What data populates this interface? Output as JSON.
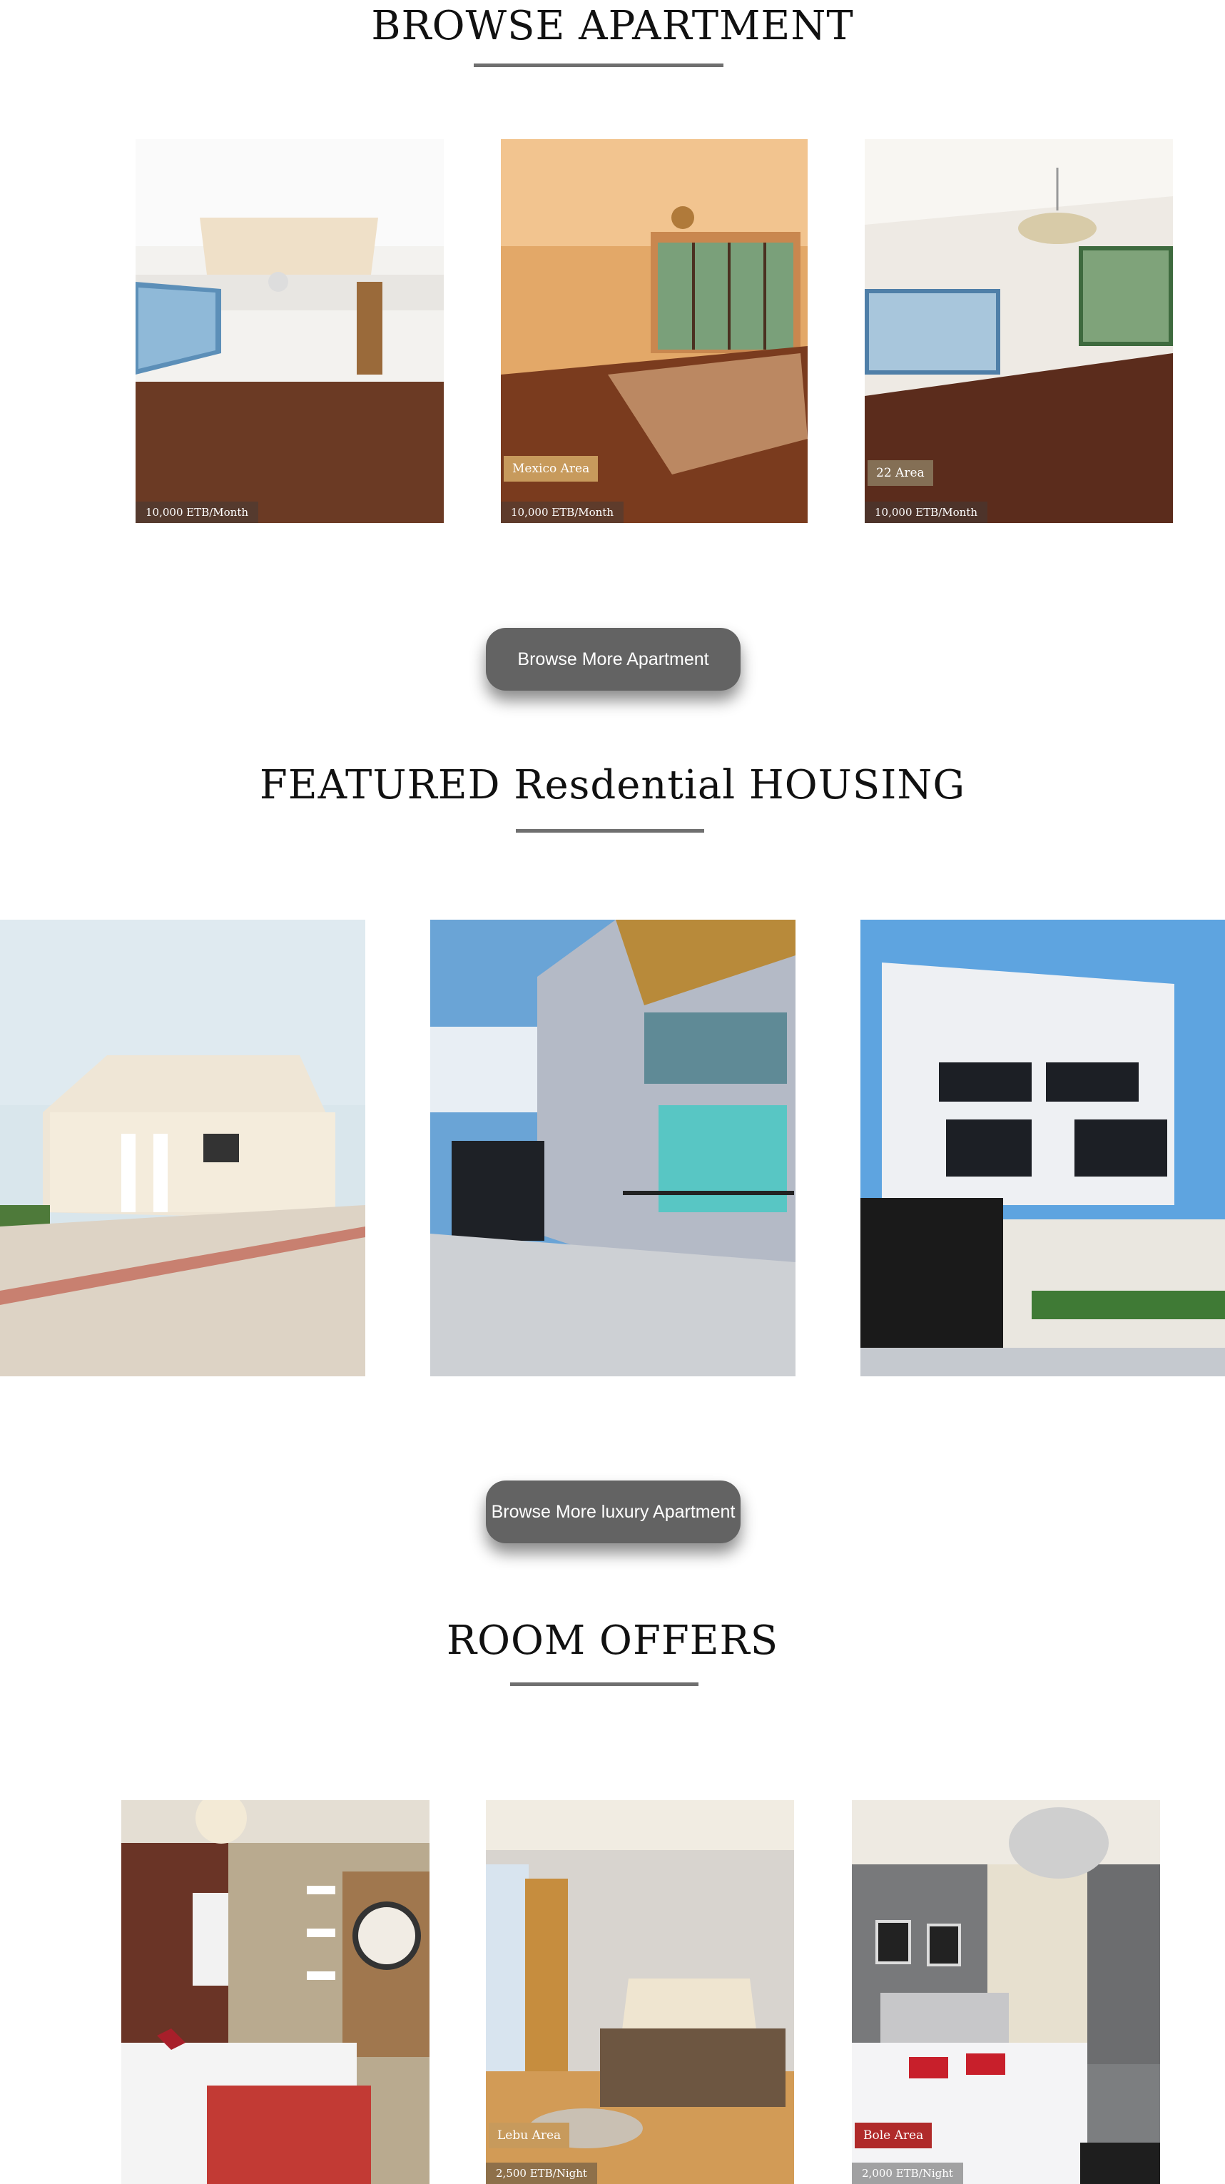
{
  "sections": {
    "apartments": {
      "title": "BROWSE APARTMENT",
      "cards": [
        {
          "price": "10,000 ETB/Month",
          "area": ""
        },
        {
          "price": "10,000 ETB/Month",
          "area": "Mexico Area"
        },
        {
          "price": "10,000 ETB/Month",
          "area": "22 Area"
        }
      ],
      "button": "Browse More Apartment"
    },
    "housing": {
      "title": "FEATURED Resdential HOUSING",
      "button": "Browse More luxury Apartment"
    },
    "rooms": {
      "title": "ROOM OFFERS",
      "cards": [
        {
          "price": "",
          "area": ""
        },
        {
          "price": "2,500 ETB/Night",
          "area": "Lebu Area"
        },
        {
          "price": "2,000 ETB/Night",
          "area": "Bole Area"
        }
      ]
    }
  },
  "colors": {
    "accent_gray": "#636363",
    "tag_tan": "#c79a5c",
    "tag_red": "#b02a2a"
  }
}
